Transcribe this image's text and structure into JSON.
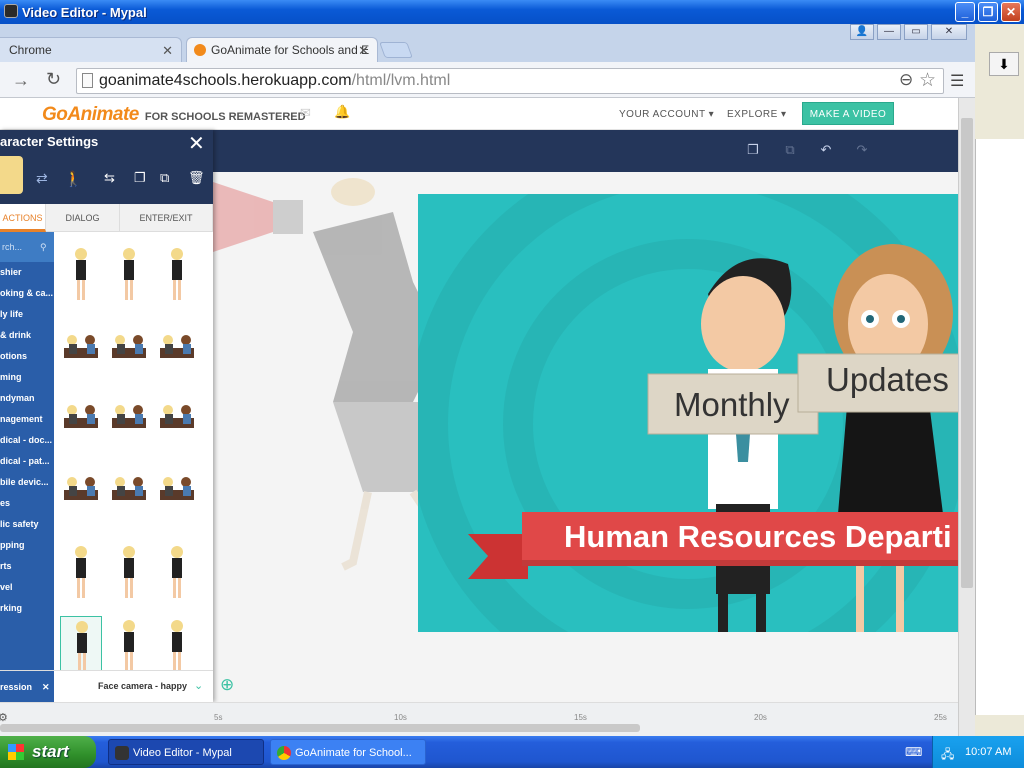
{
  "window": {
    "title": "Video Editor - Mypal"
  },
  "tabs": [
    {
      "label": "Chrome"
    },
    {
      "label": "GoAnimate for Schools and E"
    }
  ],
  "address": {
    "domain": "goanimate4schools.herokuapp.com",
    "path": "/html/lvm.html"
  },
  "site": {
    "logo_main": "GoAnimate",
    "logo_sub": "FOR SCHOOLS REMASTERED",
    "nav_account": "YOUR ACCOUNT ▾",
    "nav_explore": "EXPLORE ▾",
    "make_video": "MAKE A VIDEO",
    "brand_color": "#f28a1b",
    "accent_color": "#3cc2a4"
  },
  "panel": {
    "title": "aracter Settings",
    "tabs": [
      "ACTIONS",
      "DIALOG",
      "ENTER/EXIT"
    ],
    "search_placeholder": "rch...",
    "categories": [
      "shier",
      "oking & ca...",
      "ly life",
      "& drink",
      "otions",
      "ming",
      "ndyman",
      "nagement",
      "dical - doc...",
      "dical - pat...",
      "bile devic...",
      "es",
      "lic safety",
      "pping",
      "rts",
      "vel",
      "rking"
    ],
    "expression_label": "ression",
    "expression_value": "Face camera - happy"
  },
  "stage": {
    "sign_left": "Monthly",
    "sign_right": "Updates",
    "banner": "Human Resources Departi",
    "bg_color": "#29bfbf",
    "banner_color": "#e04848"
  },
  "timeline": {
    "ticks": [
      "5s",
      "10s",
      "15s",
      "20s",
      "25s"
    ]
  },
  "taskbar": {
    "start": "start",
    "items": [
      "Video Editor - Mypal",
      "GoAnimate for School..."
    ],
    "clock": "10:07 AM"
  }
}
